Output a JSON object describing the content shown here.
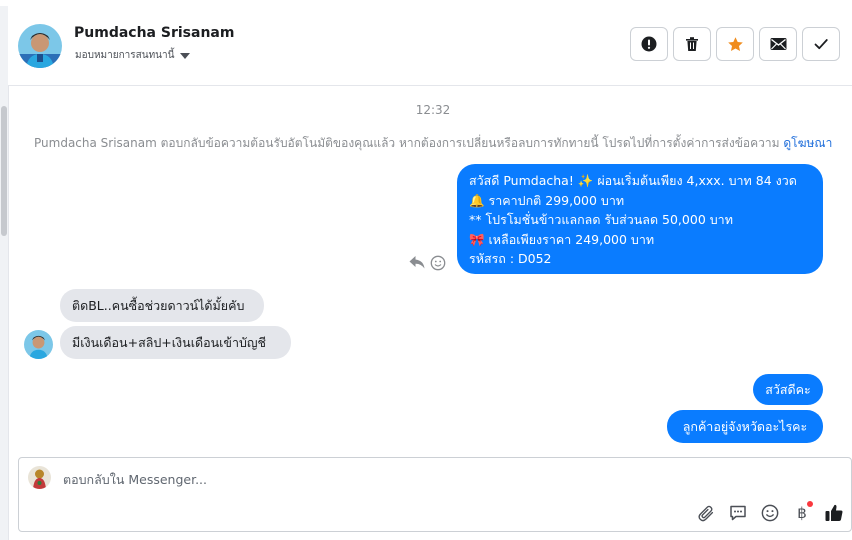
{
  "header": {
    "contact_name": "Pumdacha Srisanam",
    "assign_label": "มอบหมายการสนทนานี้",
    "actions": [
      "mark-spam",
      "delete",
      "star",
      "mark-unread",
      "mark-done"
    ]
  },
  "conversation": {
    "timestamp": "12:32",
    "notice_text": "Pumdacha Srisanam ตอบกลับข้อความต้อนรับอัตโนมัติของคุณแล้ว หากต้องการเปลี่ยนหรือลบการทักทายนี้ โปรดไปที่การตั้งค่าการส่งข้อความ ",
    "notice_link": "ดูโฆษณา",
    "greeting_lines": [
      "สวัสดี Pumdacha! ✨  ผ่อนเริ่มต้นเพียง 4,xxx. บาท 84 งวด",
      "🔔 ราคาปกติ  299,000 บาท",
      "** โปรโมชั่นข้าวแลกลด รับส่วนลด 50,000 บาท",
      "🎀  เหลือเพียงราคา 249,000 บาท",
      " รหัสรถ : D052"
    ],
    "incoming": [
      "ติดBL..คนซื้อช่วยดาวน์ได้มั้ยคับ",
      "มีเงินเดือน+สลิป+เงินเดือนเข้าบัญชี"
    ],
    "outgoing": [
      "สวัสดีคะ",
      "ลูกค้าอยู่จังหวัดอะไรคะ"
    ]
  },
  "composer": {
    "placeholder": "ตอบกลับใน Messenger...",
    "tools": [
      "attach-icon",
      "saved-reply-icon",
      "emoji-icon",
      "payment-icon",
      "like-icon"
    ],
    "baht_symbol": "฿"
  },
  "colors": {
    "accent": "#0a7cff",
    "incoming_bubble": "#e4e6eb",
    "star": "#f08c1d",
    "link": "#216fdb",
    "notification_dot": "#fa383e"
  }
}
